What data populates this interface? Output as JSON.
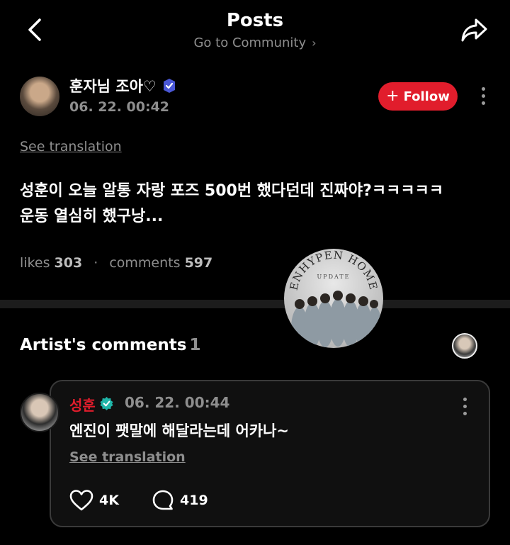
{
  "header": {
    "title": "Posts",
    "subtitle": "Go to Community",
    "subtitle_chevron": "›"
  },
  "post": {
    "author": "훈자님 조아♡",
    "time": "06. 22. 00:42",
    "follow_label": "Follow",
    "follow_plus": "+",
    "see_translation": "See translation",
    "body_line1": "성훈이 오늘 알통 자랑 포즈 500번 했다던데 진짜야?ㅋㅋㅋㅋㅋ",
    "body_line2": "운동 열심히 했구낭...",
    "likes_label": "likes",
    "likes_count": "303",
    "separator": "·",
    "comments_label": "comments",
    "comments_count": "597"
  },
  "watermark": {
    "top_text": "ENHYPEN HOME",
    "sub_text": "UPDATE"
  },
  "artist_comments": {
    "heading": "Artist's comments",
    "count": "1"
  },
  "comment": {
    "name": "성훈",
    "time": "06. 22. 00:44",
    "text": "엔진이 팻말에 해달라는데 어카나~",
    "see_translation": "See translation",
    "likes": "4K",
    "replies": "419"
  },
  "colors": {
    "accent": "#e11d2c",
    "muted": "#8e8e8e",
    "badge_teal": "#1fb5a8",
    "badge_blue": "#4a57d6"
  },
  "icons": [
    "back-arrow-icon",
    "share-icon",
    "verified-icon",
    "more-icon",
    "heart-icon",
    "comment-bubble-icon"
  ]
}
